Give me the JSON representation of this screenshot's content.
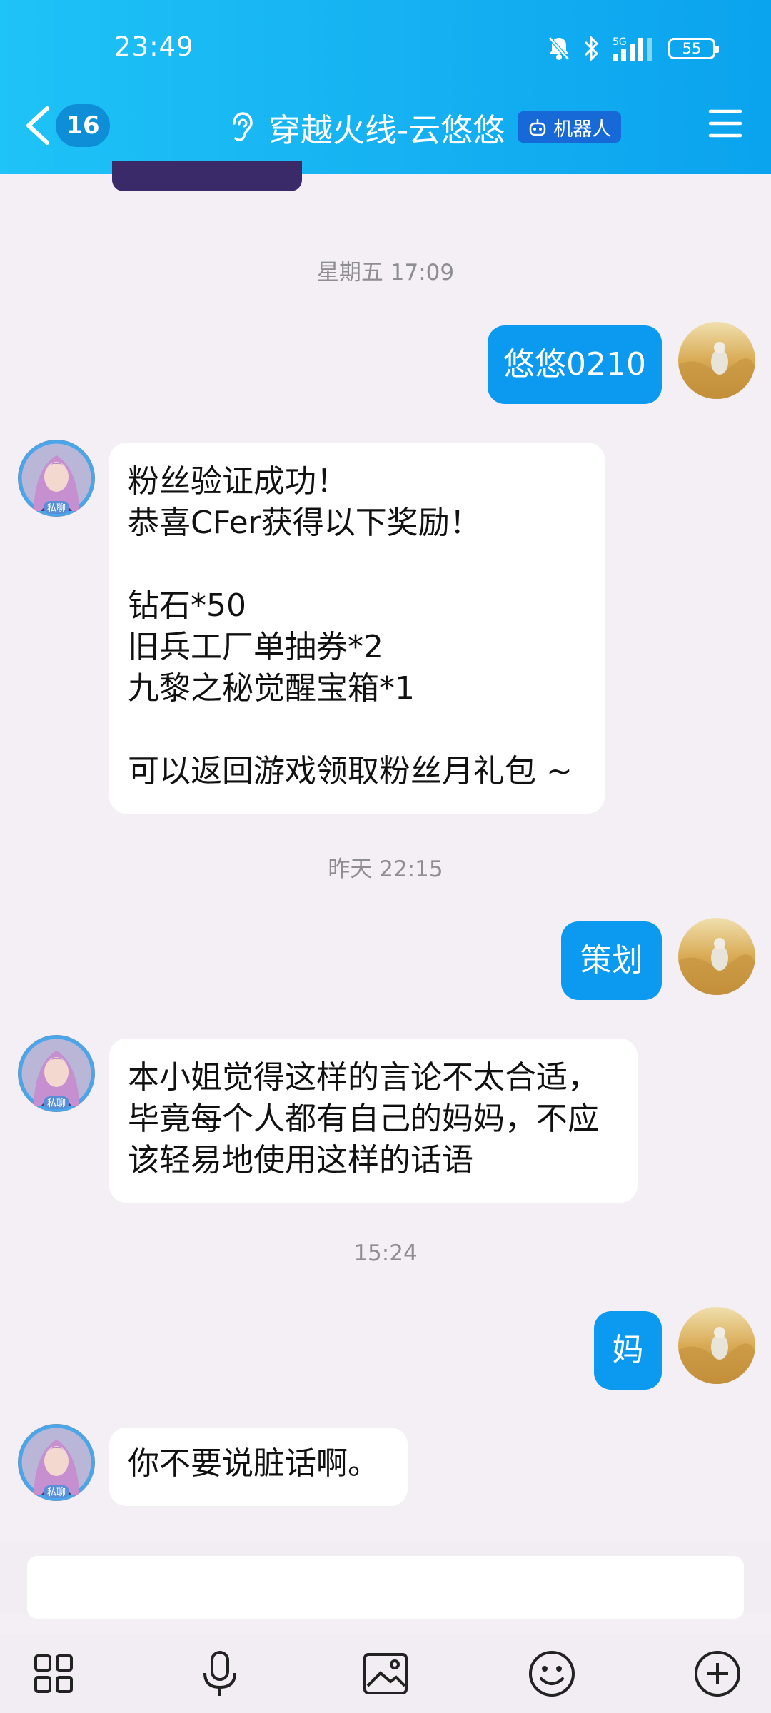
{
  "status_bar": {
    "time": "23:49",
    "battery": "55",
    "network": "5G"
  },
  "header": {
    "unread_count": "16",
    "title": "穿越火线-云悠悠",
    "bot_tag": "机器人"
  },
  "icons": {
    "back": "back-chevron-icon",
    "listen": "ear-icon",
    "robot": "robot-icon",
    "menu": "menu-icon",
    "apps": "apps-grid-icon",
    "voice": "microphone-icon",
    "image": "image-icon",
    "emoji": "emoji-icon",
    "plus": "plus-circle-icon"
  },
  "colors": {
    "header": "#16b2f2",
    "outgoing_bubble": "#0c99f0",
    "background": "#f4eff4"
  },
  "bot_avatar_label": "私聊",
  "messages": [
    {
      "timestamp": "星期五 17:09"
    },
    {
      "outgoing": "悠悠0210"
    },
    {
      "incoming_lines": [
        "粉丝验证成功！",
        "恭喜CFer获得以下奖励！",
        "",
        "钻石*50",
        "旧兵工厂单抽券*2",
        "九黎之秘觉醒宝箱*1",
        "",
        "可以返回游戏领取粉丝月礼包 ~"
      ]
    },
    {
      "timestamp": "昨天 22:15"
    },
    {
      "outgoing": "策划"
    },
    {
      "incoming_lines": [
        "本小姐觉得这样的言论不太合适，",
        "毕竟每个人都有自己的妈妈，不应",
        "该轻易地使用这样的话语"
      ]
    },
    {
      "timestamp": "15:24"
    },
    {
      "outgoing": "妈"
    },
    {
      "incoming_lines": [
        "你不要说脏话啊。"
      ]
    }
  ],
  "input": {
    "value": "",
    "placeholder": ""
  }
}
